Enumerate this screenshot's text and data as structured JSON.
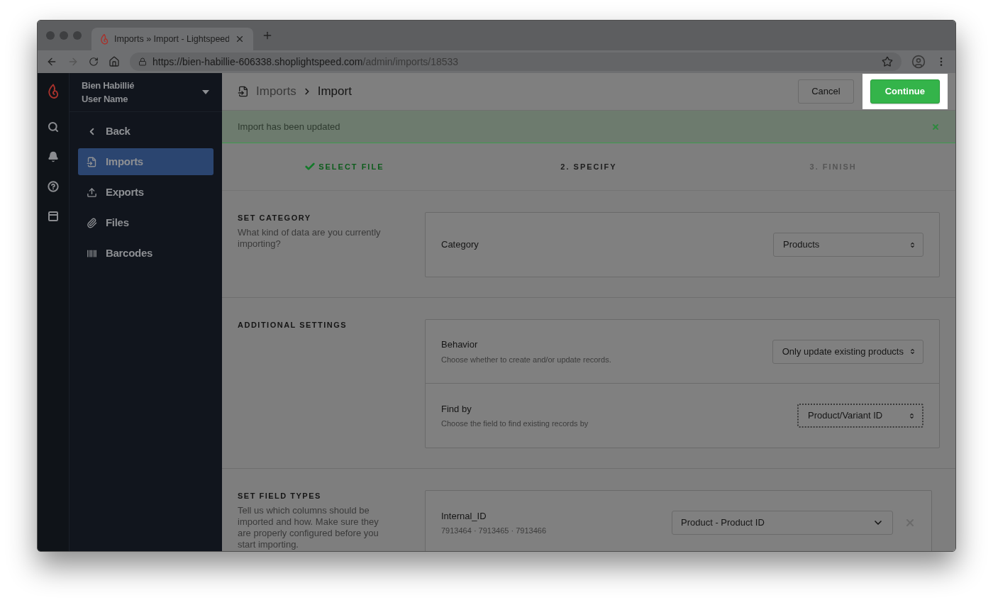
{
  "browser": {
    "tab_title": "Imports » Import - Lightspeed",
    "url_host": "https://bien-habillie-606338.shoplightspeed.com",
    "url_path": "/admin/imports/18533"
  },
  "account": {
    "shop": "Bien Habillié",
    "user": "User Name"
  },
  "sidebar": {
    "items": [
      {
        "label": "Back",
        "kind": "back",
        "selected": false
      },
      {
        "label": "Imports",
        "kind": "imports",
        "selected": true
      },
      {
        "label": "Exports",
        "kind": "exports",
        "selected": false
      },
      {
        "label": "Files",
        "kind": "files",
        "selected": false
      },
      {
        "label": "Barcodes",
        "kind": "barcodes",
        "selected": false
      }
    ]
  },
  "breadcrumb": [
    "Imports",
    "Import"
  ],
  "actions": [
    {
      "label": "Cancel",
      "kind": "secondary",
      "highlighted": false
    },
    {
      "label": "Continue",
      "kind": "primary",
      "highlighted": true
    }
  ],
  "banner": {
    "message": "Import has been updated"
  },
  "steps": [
    {
      "label": "SELECT FILE",
      "done": true,
      "selected": false
    },
    {
      "label": "2. SPECIFY",
      "done": false,
      "selected": true
    },
    {
      "label": "3. FINISH",
      "done": false,
      "selected": false
    }
  ],
  "sections": [
    {
      "title": "SET CATEGORY",
      "description": "What kind of data are you currently importing?",
      "rows": [
        {
          "label": "Category",
          "value": "Products",
          "kind": "select",
          "focused": false
        }
      ]
    },
    {
      "title": "ADDITIONAL SETTINGS",
      "rows": [
        {
          "label": "Behavior",
          "hint": "Choose whether to create and/or update records.",
          "value": "Only update existing products",
          "kind": "select",
          "focused": false
        },
        {
          "label": "Find by",
          "hint": "Choose the field to find existing records by",
          "value": "Product/Variant ID",
          "kind": "select",
          "focused": true
        }
      ]
    },
    {
      "title": "SET FIELD TYPES",
      "description": "Tell us which columns should be imported and how. Make sure they are properly configured before you start importing.",
      "rows": [
        {
          "label": "Internal_ID",
          "hint": "7913464 · 7913465 · 7913466",
          "value": "Product - Product ID",
          "kind": "dropdown",
          "focused": false
        }
      ]
    }
  ]
}
